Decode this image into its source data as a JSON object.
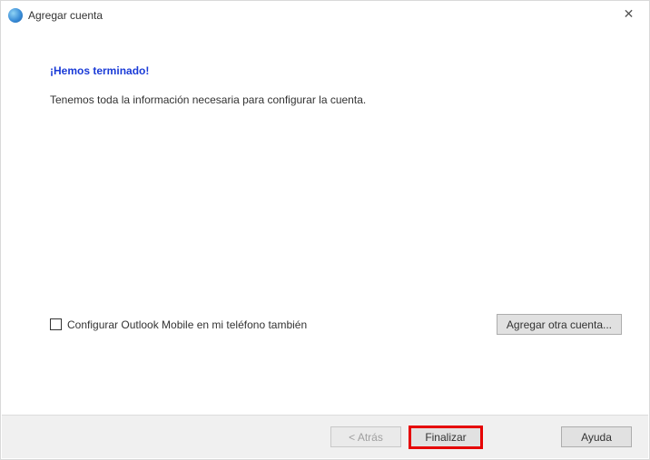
{
  "titlebar": {
    "title": "Agregar cuenta"
  },
  "content": {
    "heading": "¡Hemos terminado!",
    "subtext": "Tenemos toda la información necesaria para configurar la cuenta."
  },
  "lower": {
    "checkbox_label": "Configurar Outlook Mobile en mi teléfono también",
    "add_account_label": "Agregar otra cuenta..."
  },
  "footer": {
    "back_label": "< Atrás",
    "finish_label": "Finalizar",
    "help_label": "Ayuda"
  }
}
